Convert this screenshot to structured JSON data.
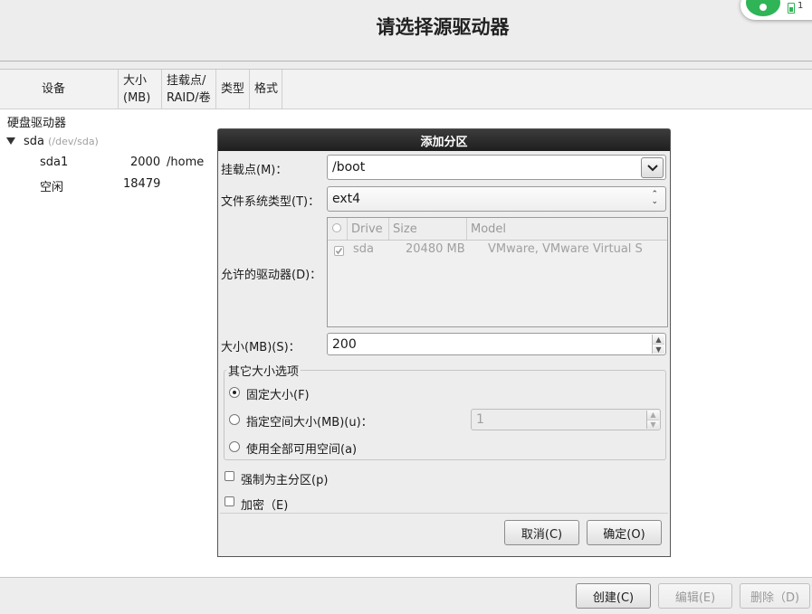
{
  "page": {
    "title": "请选择源驱动器",
    "status_count": "1"
  },
  "tree": {
    "columns": [
      "设备",
      "大小\n(MB)",
      "挂载点/\nRAID/卷",
      "类型",
      "格式"
    ],
    "group_label": "硬盘驱动器",
    "disk": {
      "name": "sda",
      "path": "(/dev/sda)"
    },
    "rows": [
      {
        "device": "sda1",
        "size": "2000",
        "mount": "/home"
      },
      {
        "device": "空闲",
        "size": "18479",
        "mount": ""
      }
    ]
  },
  "dialog": {
    "title": "添加分区",
    "mount_label": "挂载点(M)：",
    "mount_value": "/boot",
    "fstype_label": "文件系统类型(T)：",
    "fstype_value": "ext4",
    "drives_label": "允许的驱动器(D)：",
    "drive_columns": [
      "Drive",
      "Size",
      "Model"
    ],
    "drives": [
      {
        "drive": "sda",
        "size": "20480 MB",
        "model": "VMware, VMware Virtual S",
        "checked": true
      }
    ],
    "size_label": "大小(MB)(S)：",
    "size_value": "200",
    "other_size_title": "其它大小选项",
    "opt_fixed": "固定大小(F)",
    "opt_upto": "指定空间大小(MB)(u)：",
    "opt_upto_value": "1",
    "opt_fill": "使用全部可用空间(a)",
    "selected_option": "fixed",
    "force_primary": "强制为主分区(p)",
    "encrypt": "加密（E)",
    "cancel": "取消(C)",
    "ok": "确定(O)"
  },
  "actions": {
    "create": "创建(C)",
    "edit": "编辑(E)",
    "delete": "删除（D)"
  },
  "colors": {
    "dialog_title_bg": "#2a2a2a",
    "status_green": "#2fb457",
    "disabled_text": "#9a9a9a"
  }
}
